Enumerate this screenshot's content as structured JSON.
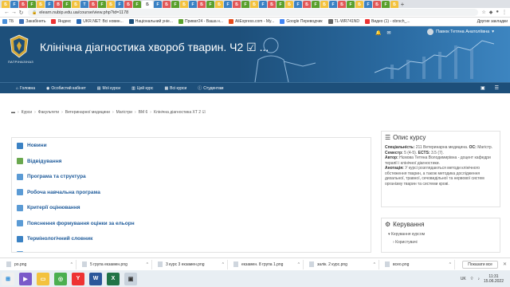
{
  "browser": {
    "url": "elearn.nubip.edu.ua/course/view.php?id=1178",
    "tab_letters": [
      "Б",
      "F",
      "Б",
      "F",
      "Б",
      "F",
      "В",
      "F",
      "Б",
      "Т",
      "Б",
      "F",
      "Б",
      "F",
      "Б",
      "F",
      "Б",
      "F",
      "Б",
      "F",
      "Б",
      "F",
      "Б",
      "F",
      "Б",
      "F",
      "Б",
      "F",
      "Б",
      "F",
      "Б",
      "F",
      "Б",
      "F",
      "Б",
      "F",
      "Б",
      "F",
      "Б",
      "F",
      "Б",
      "F",
      "Б",
      "F",
      "Б"
    ],
    "bookmarks": [
      {
        "label": "ТБ",
        "color": "#4a90d9"
      },
      {
        "label": "Закабінеть",
        "color": "#3d6fb5"
      },
      {
        "label": "Яндекс",
        "color": "#e33"
      },
      {
        "label": "UKR.NET: Всі новин...",
        "color": "#2a6ab5"
      },
      {
        "label": "Національний уніе...",
        "color": "#1d4f7a"
      },
      {
        "label": "Приват24 - Ваша н...",
        "color": "#5aa02c"
      },
      {
        "label": "AliExpress.com - My...",
        "color": "#e64a19"
      },
      {
        "label": "Google Переводчик",
        "color": "#4285f4"
      },
      {
        "label": "TL-WR741ND",
        "color": "#666"
      },
      {
        "label": "Видео (1) - obrsch_...",
        "color": "#e33"
      }
    ],
    "bookmarks_right": "Другие закладки"
  },
  "header": {
    "course_title": "Клінічна діагностика хвороб тварин. Ч2 ☑ ...",
    "logo_text": "ПАТРІНАЗІНАЗ",
    "user_name": "Павюк Тетяна Анатоліївна"
  },
  "nav": {
    "items": [
      "Головна",
      "Особистий кабінет",
      "Мої курси",
      "Цей курс",
      "Всі курси",
      "Студентам"
    ]
  },
  "breadcrumb": [
    "Курси",
    "Факультети",
    "Ветеринарної медицини",
    "Магістри",
    "ВМ 6",
    "Клінічна діагностика ХТ 2 ☑"
  ],
  "activities": [
    {
      "label": "Новини",
      "color": "#3b82c4"
    },
    {
      "label": "Відвідування",
      "color": "#6aa84f"
    },
    {
      "label": "Програма та структура",
      "color": "#5b9bd5"
    },
    {
      "label": "Робоча навчальна програма",
      "color": "#5b9bd5"
    },
    {
      "label": "Критерії оцінювання",
      "color": "#5b9bd5"
    },
    {
      "label": "Пояснення формування оцінки за ельорн",
      "color": "#5b9bd5"
    },
    {
      "label": "Термінологічний словник",
      "color": "#3b82c4"
    },
    {
      "label": "Літературні джерела",
      "color": "#5b9bd5"
    }
  ],
  "course_info": {
    "heading": "Опис курсу",
    "specialty_label": "Спеціальність:",
    "specialty": "211 Ветеринарна медицина.",
    "level_label": "ОС:",
    "level": "Магістр.",
    "semester_label": "Семестр:",
    "semester": "5 (4-5).",
    "ects_label": "ECTS:",
    "ects": "3.5 (7).",
    "author_label": "Автор:",
    "author": "Нємова Тетяна Володимирівна - доцент кафедри терапії і клінічної діагностики.",
    "annotation_label": "Анотація:",
    "annotation": "У курсі розглядаються методи клінічного обстеження тварин, а також методика дослідження дихальної, травної, сечовидільної та нервової систем організму тварин та системи крові."
  },
  "management": {
    "heading": "Керування",
    "items": [
      "Керування курсом",
      "Користувачі"
    ]
  },
  "downloads": {
    "items": [
      "ро.png",
      "5 група екзамен.png",
      "3 курс 3 екзамен.png",
      "екзамен. 8 група 1.png",
      "залік. 2 курс.png",
      "всео.png"
    ],
    "show_all": "Показати все"
  },
  "taskbar": {
    "time": "11:31",
    "date": "15.06.2022",
    "lang": "UK"
  }
}
